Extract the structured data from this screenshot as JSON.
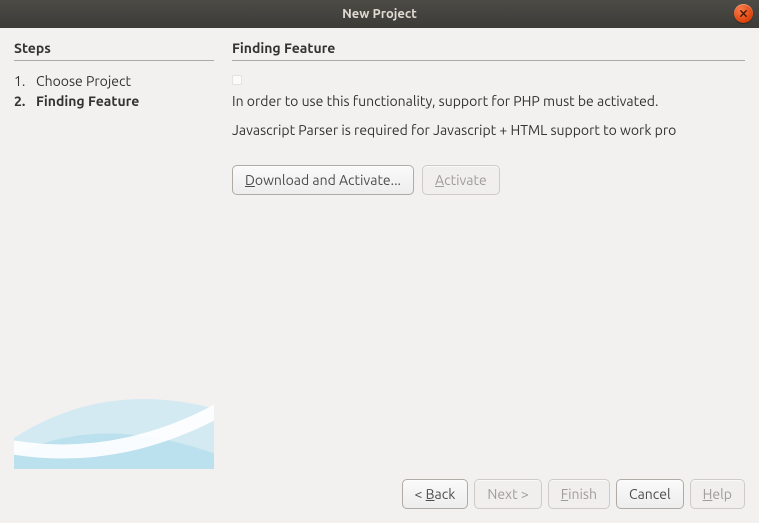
{
  "window": {
    "title": "New Project"
  },
  "sidebar": {
    "heading": "Steps",
    "steps": [
      {
        "label": "Choose Project",
        "current": false
      },
      {
        "label": "Finding Feature",
        "current": true
      }
    ]
  },
  "main": {
    "heading": "Finding Feature",
    "msg1": "In order to use this functionality, support for PHP must be activated.",
    "msg2": "Javascript Parser is required for Javascript + HTML support to work pro",
    "download_prefix": "D",
    "download_rest": "ownload and Activate...",
    "activate_prefix": "A",
    "activate_rest": "ctivate"
  },
  "buttons": {
    "back_prefix": "< ",
    "back_u": "B",
    "back_rest": "ack",
    "next": "Next >",
    "finish_u": "F",
    "finish_rest": "inish",
    "cancel": "Cancel",
    "help_u": "H",
    "help_rest": "elp"
  }
}
